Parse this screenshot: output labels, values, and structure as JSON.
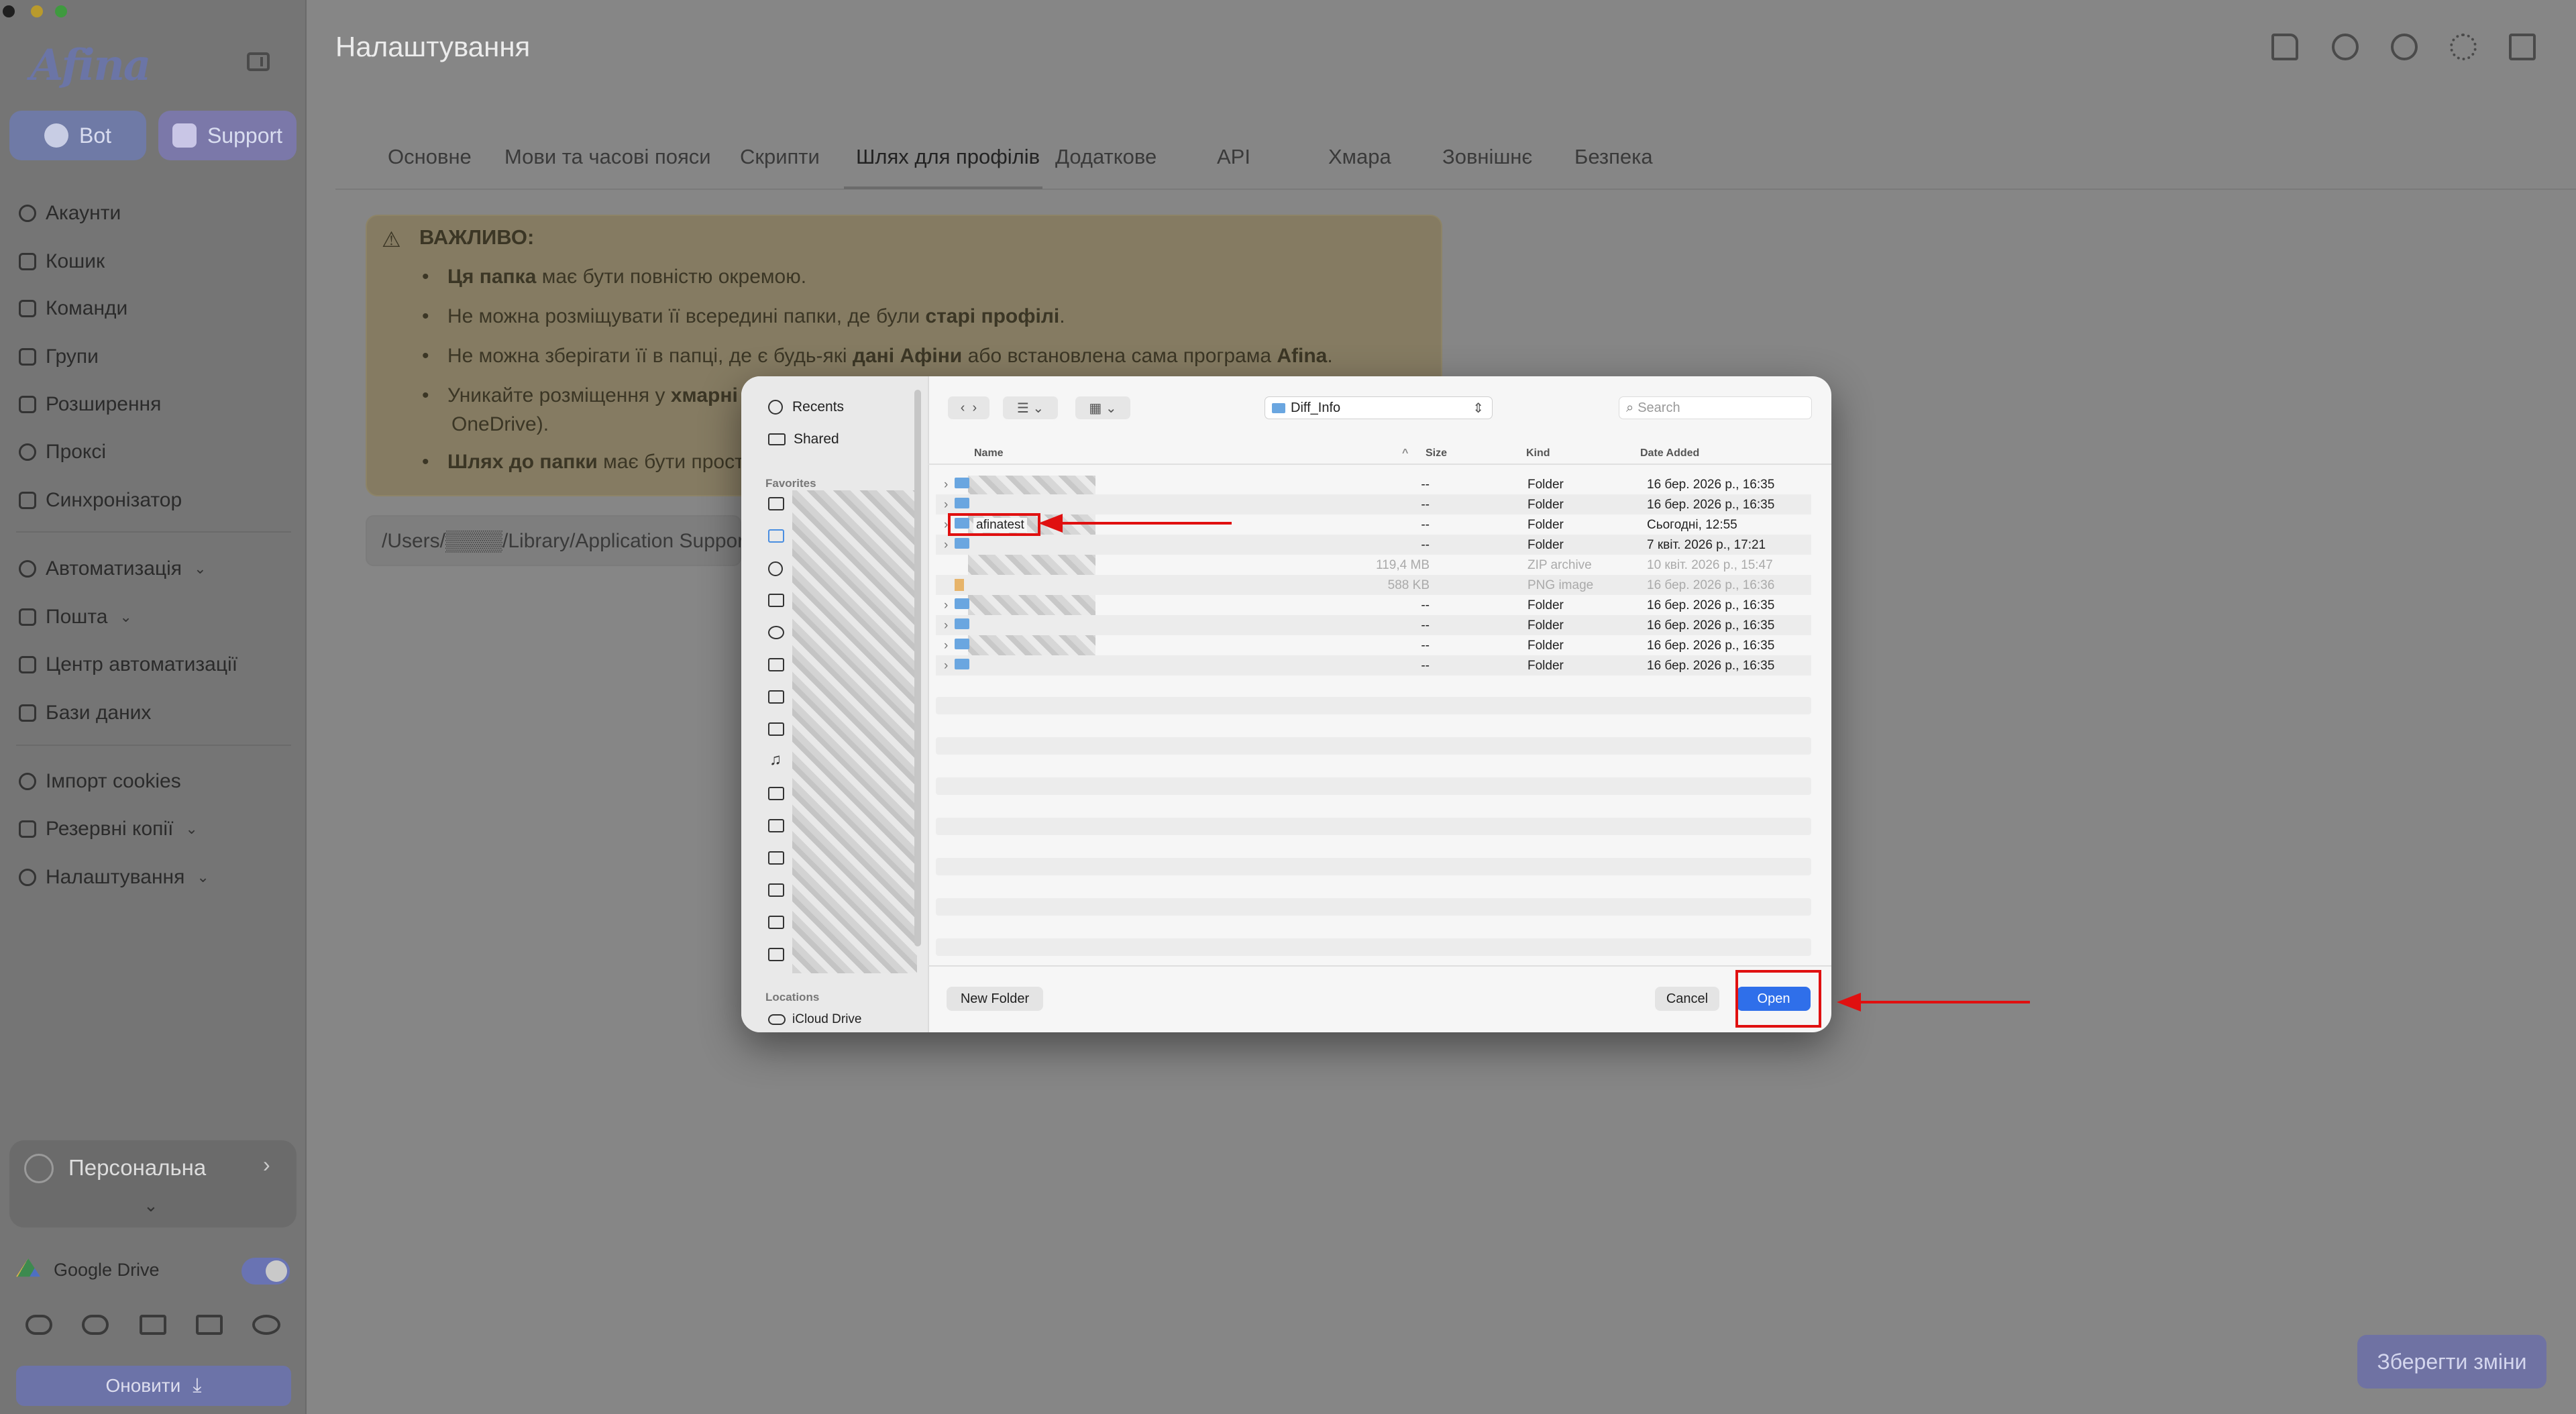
{
  "window": {
    "title": "Налаштування"
  },
  "sidebar": {
    "logo": "Afina",
    "buttons": {
      "bot": "Bot",
      "support": "Support"
    },
    "items": [
      {
        "label": "Акаунти"
      },
      {
        "label": "Кошик"
      },
      {
        "label": "Команди"
      },
      {
        "label": "Групи"
      },
      {
        "label": "Розширення"
      },
      {
        "label": "Проксі"
      },
      {
        "label": "Синхронізатор"
      },
      {
        "label": "Автоматизація",
        "expandable": true
      },
      {
        "label": "Пошта",
        "expandable": true
      },
      {
        "label": "Центр автоматизації"
      },
      {
        "label": "Бази даних"
      },
      {
        "label": "Імпорт cookies"
      },
      {
        "label": "Резервні копії",
        "expandable": true
      },
      {
        "label": "Налаштування",
        "expandable": true
      }
    ],
    "profile": "Персональна",
    "google_drive": "Google Drive",
    "update_button": "Оновити"
  },
  "tabs": [
    "Основне",
    "Мови та часові пояси",
    "Скрипти",
    "Шлях для профілів",
    "Додаткове",
    "API",
    "Хмара",
    "Зовнішнє",
    "Безпека"
  ],
  "active_tab": "Шлях для профілів",
  "warning": {
    "title": "ВАЖЛИВО:",
    "items": [
      {
        "b1": "Ця папка",
        "t1": " має бути повністю окремою."
      },
      {
        "t1": "Не можна розміщувати її всередині папки, де були ",
        "b1": "старі профілі",
        "t2": "."
      },
      {
        "t1": "Не можна зберігати її в папці, де є будь-які ",
        "b1": "дані Афіни",
        "t2": " або встановлена сама програма ",
        "b2": "Afina",
        "t3": "."
      },
      {
        "t1": "Уникайте розміщення у ",
        "b1": "хмарні",
        "t2": "OneDrive)."
      },
      {
        "b1": "Шлях до папки",
        "t1": " має бути прост"
      }
    ]
  },
  "path_value": "/Users/▒▒▒▒/Library/Application Suppor",
  "save_button": "Зберегти зміни",
  "dialog": {
    "sidebar": {
      "recents": "Recents",
      "shared": "Shared",
      "favorites_header": "Favorites",
      "locations_header": "Locations",
      "icloud": "iCloud Drive"
    },
    "location": "Diff_Info",
    "search_placeholder": "Search",
    "columns": {
      "name": "Name",
      "size": "Size",
      "kind": "Kind",
      "date": "Date Added"
    },
    "rows": [
      {
        "name": "",
        "size": "--",
        "kind": "Folder",
        "date": "16 бер. 2026 р., 16:35"
      },
      {
        "name": "",
        "size": "--",
        "kind": "Folder",
        "date": "16 бер. 2026 р., 16:35"
      },
      {
        "name": "afinatest",
        "size": "--",
        "kind": "Folder",
        "date": "Сьогодні, 12:55"
      },
      {
        "name": "",
        "size": "--",
        "kind": "Folder",
        "date": "7 квіт. 2026 р., 17:21"
      },
      {
        "name": "",
        "size": "119,4 MB",
        "kind": "ZIP archive",
        "date": "10 квіт. 2026 р., 15:47"
      },
      {
        "name": "",
        "size": "588 KB",
        "kind": "PNG image",
        "date": "16 бер. 2026 р., 16:36"
      },
      {
        "name": "",
        "size": "--",
        "kind": "Folder",
        "date": "16 бер. 2026 р., 16:35"
      },
      {
        "name": "",
        "size": "--",
        "kind": "Folder",
        "date": "16 бер. 2026 р., 16:35"
      },
      {
        "name": "",
        "size": "--",
        "kind": "Folder",
        "date": "16 бер. 2026 р., 16:35"
      },
      {
        "name": "",
        "size": "--",
        "kind": "Folder",
        "date": "16 бер. 2026 р., 16:35"
      }
    ],
    "new_folder": "New Folder",
    "cancel": "Cancel",
    "open": "Open"
  },
  "colors": {
    "accent": "#2f6fea",
    "annotation": "#e01010",
    "sidebar_accent": "#6c73a8"
  }
}
